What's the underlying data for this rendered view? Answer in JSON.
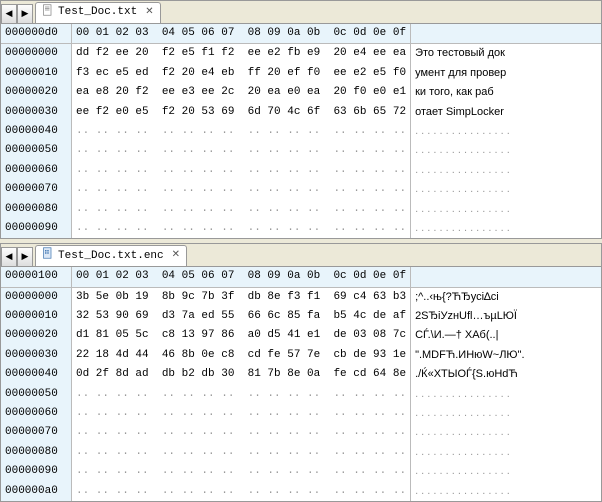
{
  "panes": [
    {
      "tab": {
        "name": "Test_Doc.txt",
        "icon": "text-file-icon"
      },
      "headerOffset": "000000d0",
      "columns": [
        "00",
        "01",
        "02",
        "03",
        "04",
        "05",
        "06",
        "07",
        "08",
        "09",
        "0a",
        "0b",
        "0c",
        "0d",
        "0e",
        "0f"
      ],
      "rows": [
        {
          "addr": "00000000",
          "hex": [
            "dd",
            "f2",
            "ee",
            "20",
            "f2",
            "e5",
            "f1",
            "f2",
            "ee",
            "e2",
            "fb",
            "e9",
            "20",
            "e4",
            "ee",
            "ea"
          ],
          "asc": "Это тестовый док"
        },
        {
          "addr": "00000010",
          "hex": [
            "f3",
            "ec",
            "e5",
            "ed",
            "f2",
            "20",
            "e4",
            "eb",
            "ff",
            "20",
            "ef",
            "f0",
            "ee",
            "e2",
            "e5",
            "f0"
          ],
          "asc": "умент для провер"
        },
        {
          "addr": "00000020",
          "hex": [
            "ea",
            "e8",
            "20",
            "f2",
            "ee",
            "e3",
            "ee",
            "2c",
            "20",
            "ea",
            "e0",
            "ea",
            "20",
            "f0",
            "e0",
            "e1"
          ],
          "asc": "ки того, как раб"
        },
        {
          "addr": "00000030",
          "hex": [
            "ee",
            "f2",
            "e0",
            "e5",
            "f2",
            "20",
            "53",
            "69",
            "6d",
            "70",
            "4c",
            "6f",
            "63",
            "6b",
            "65",
            "72"
          ],
          "asc": "отает SimpLocker"
        },
        {
          "addr": "00000040",
          "hex": null,
          "asc": null
        },
        {
          "addr": "00000050",
          "hex": null,
          "asc": null
        },
        {
          "addr": "00000060",
          "hex": null,
          "asc": null
        },
        {
          "addr": "00000070",
          "hex": null,
          "asc": null
        },
        {
          "addr": "00000080",
          "hex": null,
          "asc": null
        },
        {
          "addr": "00000090",
          "hex": null,
          "asc": null
        }
      ]
    },
    {
      "tab": {
        "name": "Test_Doc.txt.enc",
        "icon": "binary-file-icon"
      },
      "headerOffset": "00000100",
      "columns": [
        "00",
        "01",
        "02",
        "03",
        "04",
        "05",
        "06",
        "07",
        "08",
        "09",
        "0a",
        "0b",
        "0c",
        "0d",
        "0e",
        "0f"
      ],
      "rows": [
        {
          "addr": "00000000",
          "hex": [
            "3b",
            "5e",
            "0b",
            "19",
            "8b",
            "9c",
            "7b",
            "3f",
            "db",
            "8e",
            "f3",
            "f1",
            "69",
            "c4",
            "63",
            "b3"
          ],
          "asc": ";^..‹њ{?ЋЂусi∆ci"
        },
        {
          "addr": "00000010",
          "hex": [
            "32",
            "53",
            "90",
            "69",
            "d3",
            "7a",
            "ed",
            "55",
            "66",
            "6c",
            "85",
            "fa",
            "b5",
            "4c",
            "de",
            "af"
          ],
          "asc": "2SЂiУzнUfl…ъµLЮЇ"
        },
        {
          "addr": "00000020",
          "hex": [
            "d1",
            "81",
            "05",
            "5c",
            "c8",
            "13",
            "97",
            "86",
            "a0",
            "d5",
            "41",
            "e1",
            "de",
            "03",
            "08",
            "7c"
          ],
          "asc": "CЃ.\\И.—† ХАб(..|"
        },
        {
          "addr": "00000030",
          "hex": [
            "22",
            "18",
            "4d",
            "44",
            "46",
            "8b",
            "0e",
            "c8",
            "cd",
            "fe",
            "57",
            "7e",
            "cb",
            "de",
            "93",
            "1e"
          ],
          "asc": "\".MDFЋ.ИНюW~ЛЮ\"."
        },
        {
          "addr": "00000040",
          "hex": [
            "0d",
            "2f",
            "8d",
            "ad",
            "db",
            "b2",
            "db",
            "30",
            "81",
            "7b",
            "8e",
            "0a",
            "fe",
            "cd",
            "64",
            "8e"
          ],
          "asc": "./Ќ«XTЫОЃ{Ѕ.юНdЋ"
        },
        {
          "addr": "00000050",
          "hex": null,
          "asc": null
        },
        {
          "addr": "00000060",
          "hex": null,
          "asc": null
        },
        {
          "addr": "00000070",
          "hex": null,
          "asc": null
        },
        {
          "addr": "00000080",
          "hex": null,
          "asc": null
        },
        {
          "addr": "00000090",
          "hex": null,
          "asc": null
        },
        {
          "addr": "000000a0",
          "hex": null,
          "asc": null
        }
      ]
    }
  ]
}
